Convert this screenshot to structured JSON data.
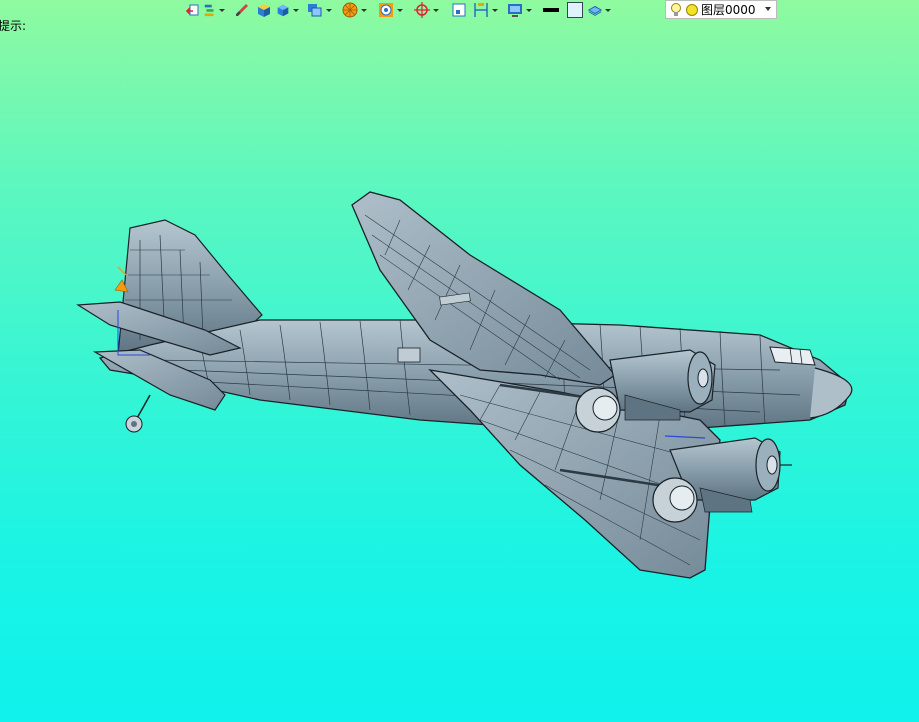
{
  "hint": {
    "label": "提示:"
  },
  "toolbar": {
    "tools": [
      "exit-sketch-icon",
      "layer-stack-icon",
      "brush-icon",
      "solid-box-icon",
      "view-cube-icon",
      "view-orientation-icon",
      "render-mode-icon",
      "snap-target-icon",
      "crosshair-icon",
      "frame-icon",
      "measure-icon",
      "display-settings-icon",
      "line-color-icon",
      "fill-color-icon",
      "layer-toggle-icon"
    ],
    "layer_select": {
      "value": "图层0000"
    }
  },
  "colors": {
    "background_top": "#8ffa9f",
    "background_bottom": "#10f2ec",
    "model_fill": "#8aa0ad",
    "model_edge": "#1a2228"
  }
}
